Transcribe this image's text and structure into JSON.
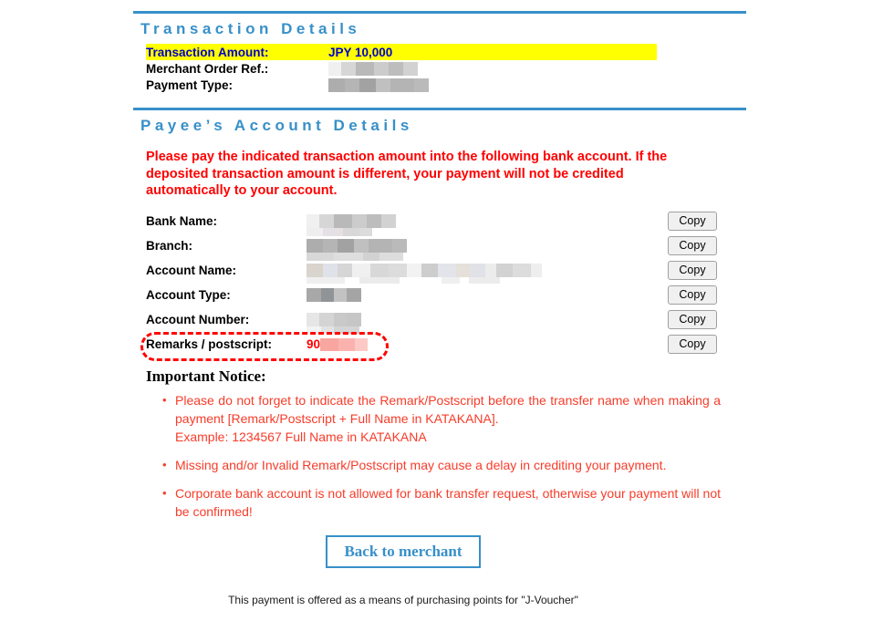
{
  "transaction_section": {
    "title": "Transaction Details",
    "rows": [
      {
        "label": "Transaction Amount:",
        "value": "JPY 10,000",
        "redacted": false,
        "highlighted": true
      },
      {
        "label": "Merchant Order Ref.:",
        "value": "",
        "redacted": true,
        "highlighted": false
      },
      {
        "label": "Payment Type:",
        "value": "",
        "redacted": true,
        "highlighted": false
      }
    ]
  },
  "payee_section": {
    "title": "Payee’s Account Details",
    "warning": "Please pay the indicated transaction amount into the following bank account. If the deposited transaction amount is different, your payment will not be credited automatically to your account.",
    "copy_label": "Copy",
    "rows": [
      {
        "label": "Bank Name:",
        "value": "",
        "redacted": true
      },
      {
        "label": "Branch:",
        "value": "",
        "redacted": true
      },
      {
        "label": "Account Name:",
        "value": "",
        "redacted": true
      },
      {
        "label": "Account Type:",
        "value": "",
        "redacted": true
      },
      {
        "label": "Account Number:",
        "value": "",
        "redacted": true
      },
      {
        "label": "Remarks / postscript:",
        "value": "90",
        "redacted": true
      }
    ]
  },
  "notice": {
    "title": "Important Notice:",
    "items": [
      {
        "text": "Please do not forget to indicate the Remark/Postscript before the transfer name when making a payment [Remark/Postscript + Full Name in KATAKANA].",
        "example": "Example: 1234567 Full Name in KATAKANA"
      },
      {
        "text": "Missing and/or Invalid Remark/Postscript may cause a delay in crediting your payment.",
        "example": ""
      },
      {
        "text": "Corporate bank account is not allowed for bank transfer request, otherwise your payment will not be confirmed!",
        "example": ""
      }
    ]
  },
  "footer": {
    "back_button": "Back to merchant",
    "note": "This payment is offered as a means of purchasing points for \"J-Voucher\""
  },
  "colors": {
    "accent_blue": "#3790c9",
    "highlight_yellow": "#ffff00",
    "amount_blue": "#0000c8",
    "warning_red": "#ff0000",
    "notice_red": "#f73c2a"
  }
}
